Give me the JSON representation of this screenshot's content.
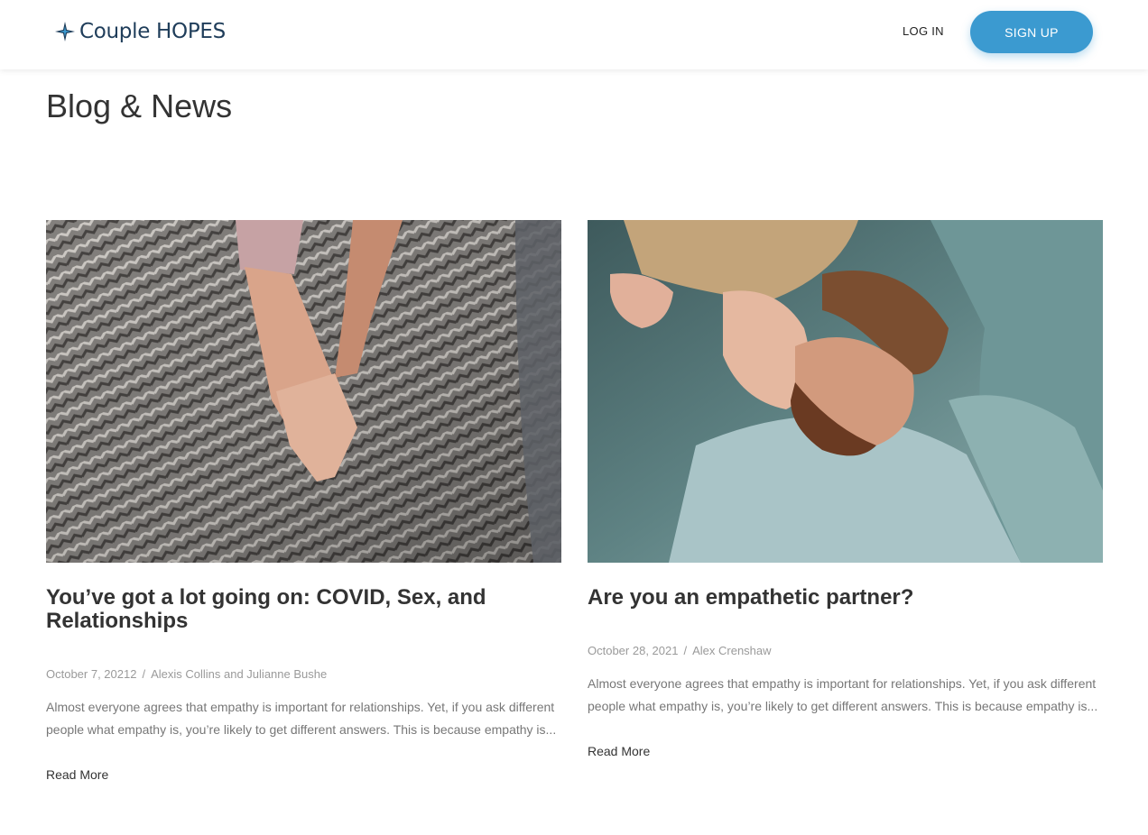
{
  "header": {
    "logo_text": "Couple HOPES",
    "login_label": "LOG IN",
    "signup_label": "SIGN UP"
  },
  "page": {
    "title": "Blog & News"
  },
  "posts": [
    {
      "title": "You’ve got a lot going on: COVID, Sex, and Relationships",
      "date": "October 7, 20212",
      "separator": "/",
      "author": "Alexis Collins and Julianne Bushe",
      "excerpt": "Almost everyone agrees that empathy is important for relationships. Yet, if you ask different people what empathy is, you’re likely to get different answers. This is because empathy is...",
      "read_more": "Read More"
    },
    {
      "title": "Are you an empathetic partner?",
      "date": "October 28, 2021",
      "separator": "/",
      "author": "Alex Crenshaw",
      "excerpt": "Almost everyone agrees that empathy is important for relationships. Yet, if you ask different people what empathy is, you’re likely to get different answers. This is because empathy is...",
      "read_more": "Read More"
    }
  ],
  "colors": {
    "brand": "#1f3d5a",
    "accent": "#3b9ad0",
    "text": "#333333",
    "muted": "#9a9a9a"
  }
}
